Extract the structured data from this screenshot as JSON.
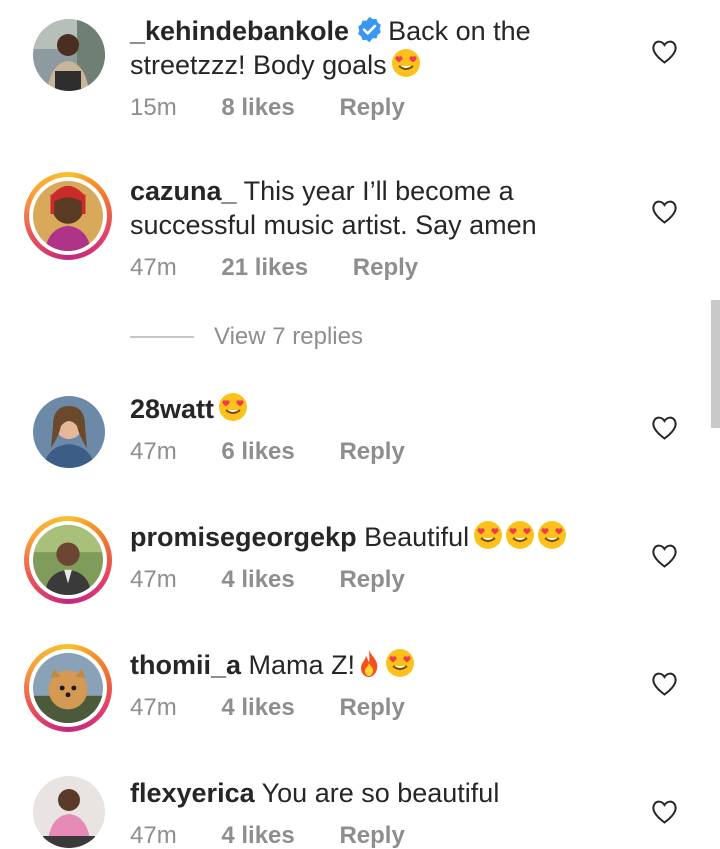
{
  "comments": [
    {
      "username": "_kehindebankole",
      "verified": true,
      "text_line1": "Back on the",
      "text_line2": "streetzzz! Body goals",
      "emojis": [
        "heart-eyes"
      ],
      "time": "15m",
      "likes": "8 likes",
      "reply": "Reply",
      "story_ring": false
    },
    {
      "username": "cazuna_",
      "verified": false,
      "text_line1": "This year I’ll become a",
      "text_line2": "successful music artist. Say amen",
      "emojis": [],
      "time": "47m",
      "likes": "21 likes",
      "reply": "Reply",
      "story_ring": true
    },
    {
      "username": "28watt",
      "verified": false,
      "text_line1": "",
      "emojis": [
        "heart-eyes"
      ],
      "time": "47m",
      "likes": "6 likes",
      "reply": "Reply",
      "story_ring": false
    },
    {
      "username": "promisegeorgekp",
      "verified": false,
      "text_line1": "Beautiful",
      "emojis": [
        "heart-eyes",
        "heart-eyes",
        "heart-eyes"
      ],
      "time": "47m",
      "likes": "4 likes",
      "reply": "Reply",
      "story_ring": true
    },
    {
      "username": "thomii_a",
      "verified": false,
      "text_line1": "Mama Z!",
      "emojis": [
        "fire",
        "heart-eyes"
      ],
      "time": "47m",
      "likes": "4 likes",
      "reply": "Reply",
      "story_ring": true
    },
    {
      "username": "flexyerica",
      "verified": false,
      "text_line1": "You are so beautiful",
      "emojis": [],
      "time": "47m",
      "likes": "4 likes",
      "reply": "Reply",
      "story_ring": false
    }
  ],
  "view_replies": {
    "label": "View 7 replies"
  },
  "icons": {
    "like": "heart-outline-icon",
    "verified": "verified-badge-icon"
  },
  "colors": {
    "text": "#262626",
    "secondary": "#8e8e8e",
    "verified": "#3897f0",
    "divider": "#c7c7c7"
  }
}
